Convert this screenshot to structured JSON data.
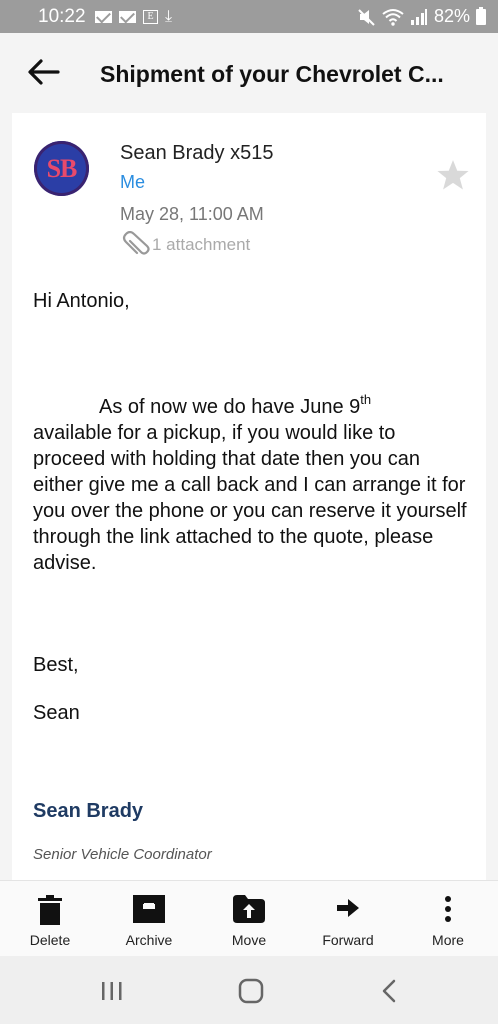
{
  "status_bar": {
    "time": "10:22",
    "battery": "82%",
    "left_icons": [
      "mail-icon",
      "mail-icon",
      "e-box-icon",
      "download-icon"
    ],
    "right_icons": [
      "mute-icon",
      "wifi-icon",
      "signal-icon",
      "battery-icon"
    ]
  },
  "header": {
    "title": "Shipment of your Chevrolet C..."
  },
  "message": {
    "avatar_initials": "SB",
    "sender": "Sean Brady x515",
    "recipient": "Me",
    "date": "May 28, 11:00 AM",
    "attachments": "1 attachment",
    "greeting": "Hi Antonio,",
    "paragraph_part1": "As of now we do have June 9",
    "paragraph_sup": "th",
    "paragraph_part2": "available for a pickup, if you would like to proceed with holding that date then you can either give me a call back and I can arrange it for you over the phone or you can reserve it yourself through the link attached to the quote, please advise.",
    "closing": "Best,",
    "signoff": "Sean",
    "signature_name": "Sean Brady",
    "signature_title": "Senior Vehicle Coordinator"
  },
  "toolbar": {
    "delete": "Delete",
    "archive": "Archive",
    "move": "Move",
    "forward": "Forward",
    "more": "More"
  },
  "colors": {
    "status_bar": "#9c9c9c",
    "link_blue": "#2a8de0",
    "signature_blue": "#1f3b63",
    "avatar_bg": "#2b3ea6",
    "avatar_text": "#e94a6b"
  }
}
